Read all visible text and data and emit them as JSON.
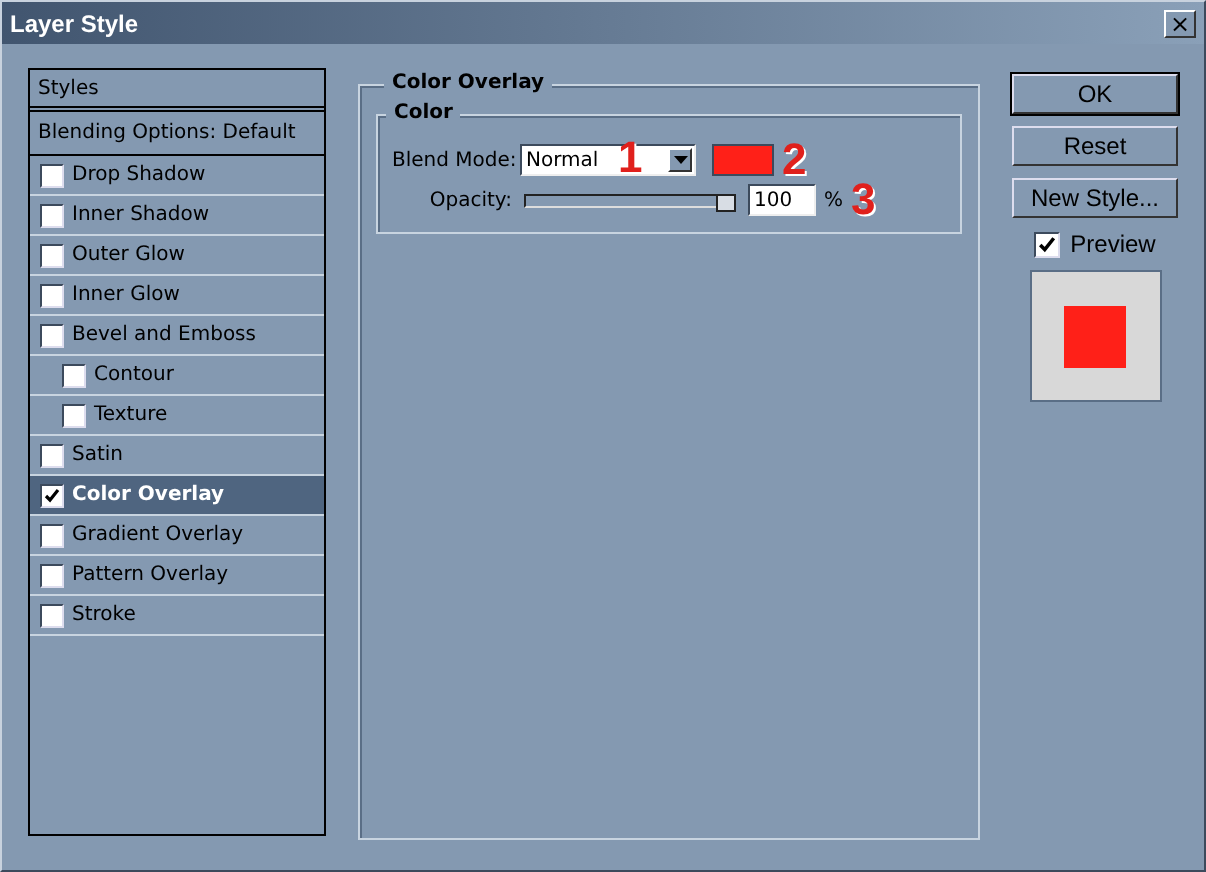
{
  "window": {
    "title": "Layer Style",
    "close": "×"
  },
  "styles_panel": {
    "header": "Styles",
    "blending": "Blending Options: Default",
    "items": [
      {
        "label": "Drop Shadow",
        "checked": false,
        "selected": false
      },
      {
        "label": "Inner Shadow",
        "checked": false,
        "selected": false
      },
      {
        "label": "Outer Glow",
        "checked": false,
        "selected": false
      },
      {
        "label": "Inner Glow",
        "checked": false,
        "selected": false
      },
      {
        "label": "Bevel and Emboss",
        "checked": false,
        "selected": false,
        "children": [
          {
            "label": "Contour",
            "checked": false,
            "selected": false
          },
          {
            "label": "Texture",
            "checked": false,
            "selected": false
          }
        ]
      },
      {
        "label": "Satin",
        "checked": false,
        "selected": false
      },
      {
        "label": "Color Overlay",
        "checked": true,
        "selected": true
      },
      {
        "label": "Gradient Overlay",
        "checked": false,
        "selected": false
      },
      {
        "label": "Pattern Overlay",
        "checked": false,
        "selected": false
      },
      {
        "label": "Stroke",
        "checked": false,
        "selected": false
      }
    ]
  },
  "color_overlay": {
    "title": "Color Overlay",
    "group": "Color",
    "blend_mode_label": "Blend Mode:",
    "blend_mode": "Normal",
    "color": "#ff2018",
    "opacity_label": "Opacity:",
    "opacity": {
      "level": 1
    },
    "opacity_value": "100",
    "unit": "%",
    "annotations": [
      "1",
      "2",
      "3"
    ]
  },
  "buttons": [
    {
      "label": "OK",
      "default": true
    },
    {
      "label": "Reset",
      "default": false
    },
    {
      "label": "New Style...",
      "default": false
    }
  ],
  "preview": {
    "label": "Preview",
    "checked": true
  }
}
